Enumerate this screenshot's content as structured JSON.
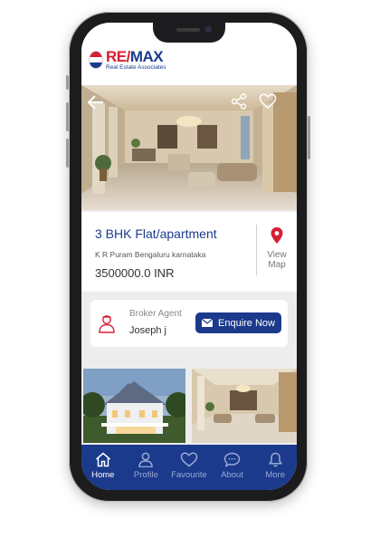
{
  "brand": {
    "name": "RE/MAX",
    "name_part1": "RE/",
    "name_part2": "MAX",
    "tagline": "Real Estate Associates",
    "colors": {
      "primary": "#1b3a8c",
      "accent": "#d61e35"
    }
  },
  "property": {
    "title": "3 BHK Flat/apartment",
    "location": "K R Puram Bengaluru karnataka",
    "price": "3500000.0 INR",
    "map_icon": "map-pin-icon",
    "view_map_label": "View Map"
  },
  "agent": {
    "role_label": "Broker Agent",
    "name": "Joseph j",
    "enquire_label": "Enquire Now"
  },
  "nav": {
    "items": [
      {
        "label": "Home",
        "icon": "home-icon",
        "active": true
      },
      {
        "label": "Profile",
        "icon": "user-icon",
        "active": false
      },
      {
        "label": "Favourite",
        "icon": "heart-icon",
        "active": false
      },
      {
        "label": "About",
        "icon": "chat-icon",
        "active": false
      },
      {
        "label": "More",
        "icon": "bell-icon",
        "active": false
      }
    ]
  }
}
